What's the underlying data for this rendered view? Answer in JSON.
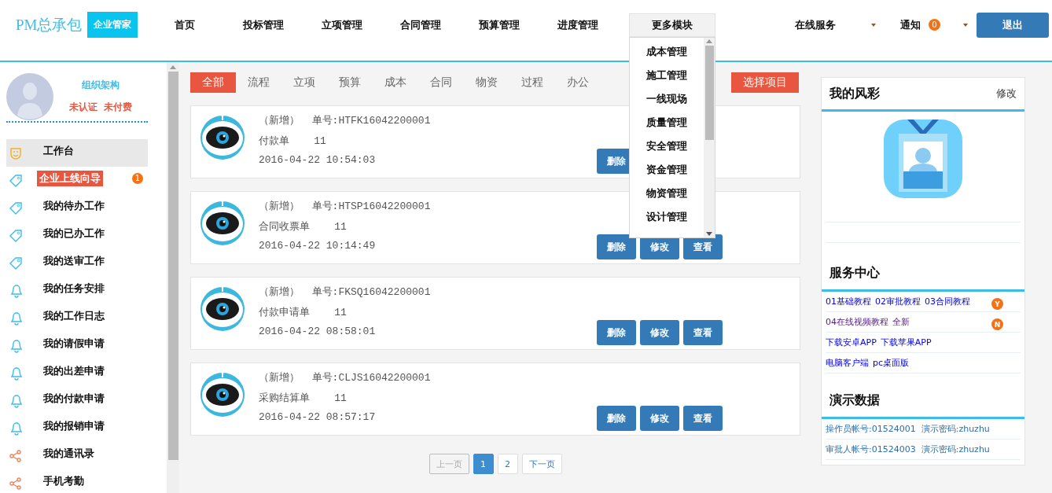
{
  "header": {
    "logo": "PM总承包",
    "badge": "企业管家",
    "nav": [
      {
        "label": "首页",
        "expanded": false
      },
      {
        "label": "投标管理",
        "expanded": false
      },
      {
        "label": "立项管理",
        "expanded": false
      },
      {
        "label": "合同管理",
        "expanded": false
      },
      {
        "label": "预算管理",
        "expanded": false
      },
      {
        "label": "进度管理",
        "expanded": false
      },
      {
        "label": "更多模块",
        "expanded": true,
        "menu": [
          "成本管理",
          "施工管理",
          "一线现场",
          "质量管理",
          "安全管理",
          "资金管理",
          "物资管理",
          "设计管理"
        ]
      }
    ],
    "service": "在线服务",
    "notice": {
      "label": "通知",
      "count": "0"
    },
    "logout": "退出"
  },
  "sidebar": {
    "org": "组织架构",
    "status": [
      "未认证",
      "未付费"
    ],
    "items": [
      {
        "label": "工作台",
        "kind": "desk",
        "selected": true,
        "highlight": false
      },
      {
        "label": "企业上线向导",
        "kind": "work",
        "selected": false,
        "highlight": true,
        "badge": "1"
      },
      {
        "label": "我的待办工作",
        "kind": "work",
        "selected": false,
        "highlight": false
      },
      {
        "label": "我的已办工作",
        "kind": "work",
        "selected": false,
        "highlight": false
      },
      {
        "label": "我的送审工作",
        "kind": "work",
        "selected": false,
        "highlight": false
      },
      {
        "label": "我的任务安排",
        "kind": "apply",
        "selected": false,
        "highlight": false
      },
      {
        "label": "我的工作日志",
        "kind": "apply",
        "selected": false,
        "highlight": false
      },
      {
        "label": "我的请假申请",
        "kind": "apply",
        "selected": false,
        "highlight": false
      },
      {
        "label": "我的出差申请",
        "kind": "apply",
        "selected": false,
        "highlight": false
      },
      {
        "label": "我的付款申请",
        "kind": "apply",
        "selected": false,
        "highlight": false
      },
      {
        "label": "我的报销申请",
        "kind": "apply",
        "selected": false,
        "highlight": false
      },
      {
        "label": "我的通讯录",
        "kind": "link",
        "selected": false,
        "highlight": false
      },
      {
        "label": "手机考勤",
        "kind": "link",
        "selected": false,
        "highlight": false
      }
    ]
  },
  "filters": [
    {
      "label": "全部",
      "selected": true
    },
    {
      "label": "流程",
      "selected": false
    },
    {
      "label": "立项",
      "selected": false
    },
    {
      "label": "预算",
      "selected": false
    },
    {
      "label": "成本",
      "selected": false
    },
    {
      "label": "合同",
      "selected": false
    },
    {
      "label": "物资",
      "selected": false
    },
    {
      "label": "过程",
      "selected": false
    },
    {
      "label": "办公",
      "selected": false
    }
  ],
  "select_project": "选择项目",
  "records": [
    {
      "status": "（新增）",
      "number": "单号:HTFK16042200001",
      "type": "付款单",
      "count": "11",
      "time": "2016-04-22 10:54:03",
      "buttons": [
        "删除"
      ]
    },
    {
      "status": "（新增）",
      "number": "单号:HTSP16042200001",
      "type": "合同收票单",
      "count": "11",
      "time": "2016-04-22 10:14:49",
      "buttons": [
        "删除",
        "修改",
        "查看"
      ]
    },
    {
      "status": "（新增）",
      "number": "单号:FKSQ16042200001",
      "type": "付款申请单",
      "count": "11",
      "time": "2016-04-22 08:58:01",
      "buttons": [
        "删除",
        "修改",
        "查看"
      ]
    },
    {
      "status": "（新增）",
      "number": "单号:CLJS16042200001",
      "type": "采购结算单",
      "count": "11",
      "time": "2016-04-22 08:57:17",
      "buttons": [
        "删除",
        "修改",
        "查看"
      ]
    }
  ],
  "pagination": {
    "prev": {
      "label": "上一页",
      "disabled": true
    },
    "pages": [
      {
        "label": "1",
        "selected": true
      },
      {
        "label": "2",
        "selected": false
      }
    ],
    "next": {
      "label": "下一页",
      "disabled": false
    }
  },
  "profile": {
    "title": "我的风彩",
    "edit": "修改"
  },
  "service_center": {
    "title": "服务中心",
    "rows": [
      {
        "links": [
          "01基础教程",
          "02审批教程",
          "03合同教程"
        ],
        "visited": false,
        "badge": "Y"
      },
      {
        "links": [
          "04在线视频教程",
          "全新"
        ],
        "visited": true,
        "badge": "N"
      },
      {
        "links": [
          "下载安卓APP",
          "下载苹果APP"
        ],
        "visited": false
      },
      {
        "links": [
          "电脑客户端",
          "pc桌面版"
        ],
        "visited": false
      }
    ]
  },
  "demo": {
    "title": "演示数据",
    "rows": [
      "操作员帐号:01524001  演示密码:zhuzhu",
      "审批人帐号:01524003  演示密码:zhuzhu"
    ]
  }
}
